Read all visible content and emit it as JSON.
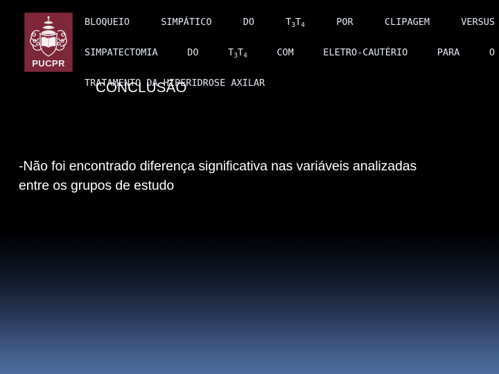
{
  "slide": {
    "background": {
      "top_color": "#000000",
      "bottom_color": "#506c9e"
    },
    "logo": {
      "name": "PUCPR",
      "wordmark": "PUCPR",
      "background_color": "#7d2739",
      "emblem_color": "#f2eef0",
      "description": "papal-tiara-and-book-coat-of-arms"
    },
    "title": {
      "lines": [
        {
          "segments": [
            {
              "type": "text",
              "value": "BLOQUEIO   SIMPÁTICO   DO   T"
            },
            {
              "type": "sub",
              "value": "3"
            },
            {
              "type": "text",
              "value": "T"
            },
            {
              "type": "sub",
              "value": "4"
            },
            {
              "type": "text",
              "value": "   POR   CLIPAGEM   VERSUS"
            }
          ],
          "plain": "BLOQUEIO SIMPÁTICO DO T3T4 POR CLIPAGEM VERSUS"
        },
        {
          "segments": [
            {
              "type": "text",
              "value": "SIMPATECTOMIA   DO   T"
            },
            {
              "type": "sub",
              "value": "3"
            },
            {
              "type": "text",
              "value": "T"
            },
            {
              "type": "sub",
              "value": "4"
            },
            {
              "type": "text",
              "value": "   COM   ELETRO-CAUTÉRIO   PARA   O"
            }
          ],
          "plain": "SIMPATECTOMIA DO T3T4 COM ELETRO-CAUTÉRIO PARA O"
        },
        {
          "segments": [
            {
              "type": "text",
              "value": "TRATAMENTO DA HIPERIDROSE AXILAR"
            }
          ],
          "plain": "TRATAMENTO DA HIPERIDROSE AXILAR"
        }
      ],
      "color": "#e4eaf4"
    },
    "heading": {
      "text": "CONCLUSÃO",
      "color": "#ffffff"
    },
    "body": {
      "lines": [
        "-Não foi encontrado diferença significativa nas variáveis analizadas",
        "entre os grupos de estudo"
      ],
      "color": "#ffffff"
    }
  }
}
